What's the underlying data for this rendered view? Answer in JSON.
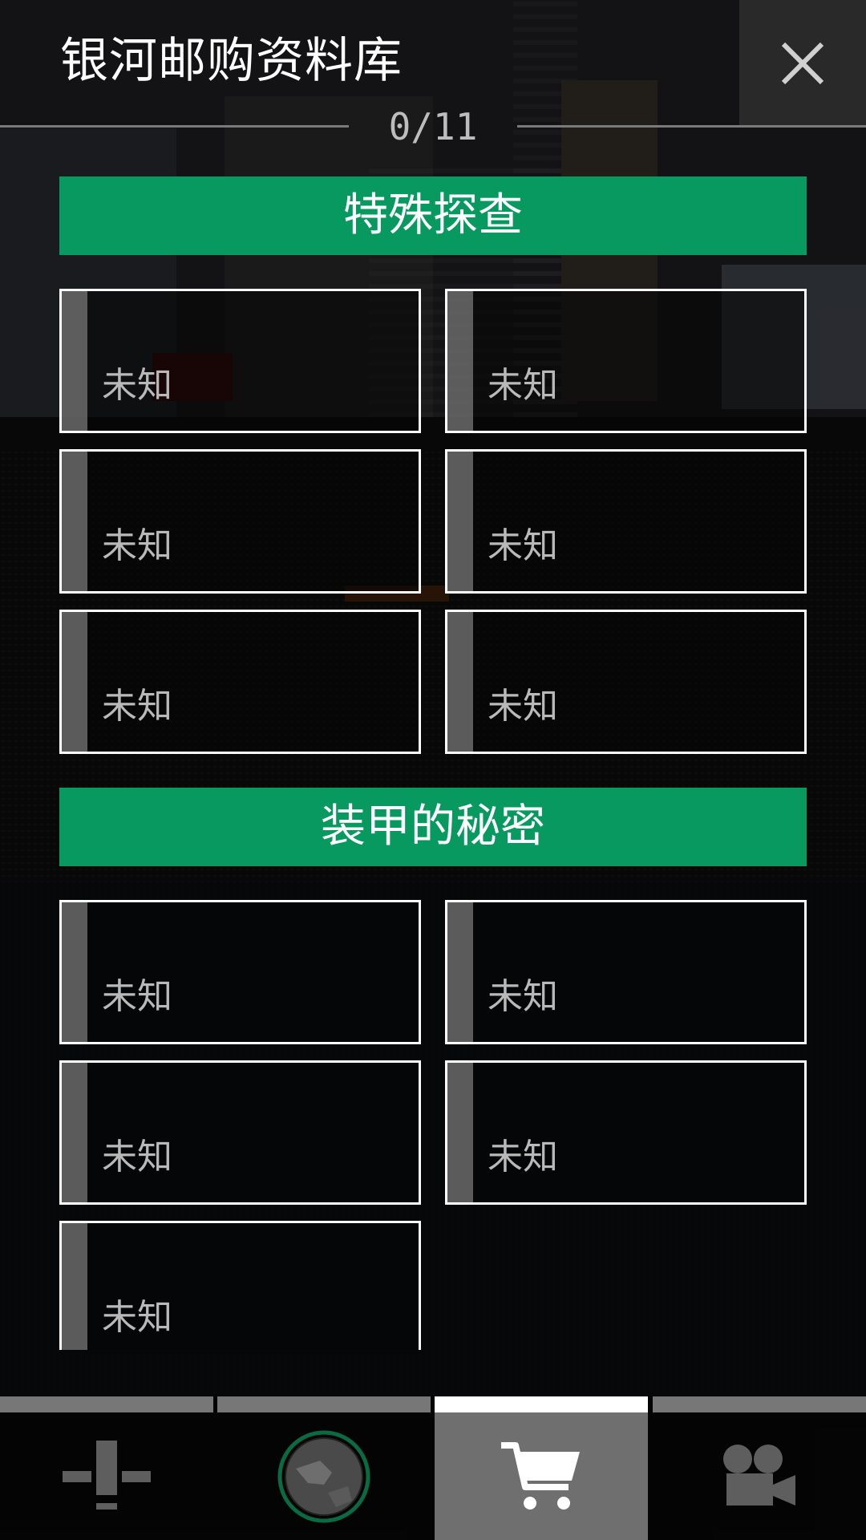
{
  "header": {
    "title": "银河邮购资料库",
    "progress": "0/11",
    "close_icon": "close-icon"
  },
  "sections": [
    {
      "title": "特殊探查",
      "items": [
        "未知",
        "未知",
        "未知",
        "未知",
        "未知",
        "未知"
      ]
    },
    {
      "title": "装甲的秘密",
      "items": [
        "未知",
        "未知",
        "未知",
        "未知",
        "未知"
      ]
    }
  ],
  "nav": {
    "tabs": [
      {
        "icon": "pilot-marker-icon",
        "active": false
      },
      {
        "icon": "planet-icon",
        "active": false
      },
      {
        "icon": "shopping-cart-icon",
        "active": true
      },
      {
        "icon": "movie-camera-icon",
        "active": false
      }
    ]
  },
  "colors": {
    "section_header": "#079960",
    "card_border": "#ffffff",
    "active_tab": "#6f6f6f"
  }
}
